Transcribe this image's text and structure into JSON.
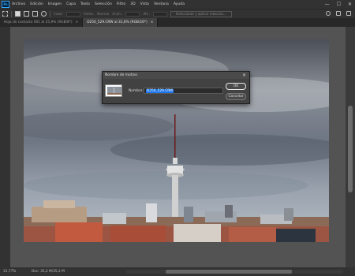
{
  "app": {
    "logo": "Ps"
  },
  "menu": [
    "Archivo",
    "Edición",
    "Imagen",
    "Capa",
    "Texto",
    "Selección",
    "Filtro",
    "3D",
    "Vista",
    "Ventana",
    "Ayuda"
  ],
  "window_controls": [
    "—",
    "☐",
    "✕"
  ],
  "options_bar": {
    "feather_label": "Calar:",
    "style_label": "Estilo:",
    "style_value": "Normal",
    "width_label": "Anch.:",
    "height_label": "Alt.:",
    "select_mask_button": "Seleccionar y aplicar máscara..."
  },
  "tabs": [
    {
      "label": "Hoja de contacto 001 al 25,9% (RGB/8*)",
      "close": "×"
    },
    {
      "label": "D250_529.CRW al 31,6% (RGB/16*)",
      "close": "×"
    }
  ],
  "dialog": {
    "title": "Nombre de motivo",
    "close": "✕",
    "name_label": "Nombre:",
    "name_value": "D250_529.CRW",
    "ok_label": "OK",
    "cancel_label": "Cancelar"
  },
  "status": {
    "zoom": "31,77%",
    "doc_info": "Doc: 35,2 M/35,2 M"
  },
  "colors": {
    "ui_dark": "#323232",
    "workspace": "#535353",
    "selection": "#1a73e8"
  }
}
